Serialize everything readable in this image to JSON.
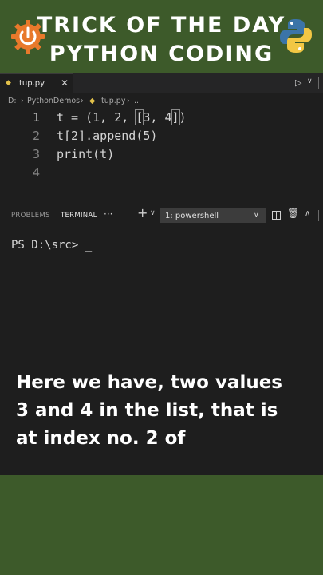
{
  "banner": {
    "line1": "TRICK OF THE DAY",
    "line2": "PYTHON CODING",
    "left_logo": "power-icon",
    "right_logo": "python-logo-icon",
    "colors": {
      "background": "#3d5a2a",
      "left_logo": "#e8792b",
      "python_blue": "#3b74a8",
      "python_yellow": "#f2c744"
    }
  },
  "editor": {
    "tab": {
      "icon": "python-file-icon",
      "label": "tup.py",
      "close": "✕"
    },
    "run_icon": "▷",
    "run_chevron": "∨",
    "breadcrumb": {
      "drive": "D:",
      "folder": "PythonDemos",
      "file": "tup.py",
      "more": "..."
    },
    "lines": [
      {
        "num": "1",
        "before": "t = (1, 2, ",
        "open": "[",
        "middle": "3, 4",
        "close": "]",
        "after": ")"
      },
      {
        "num": "2",
        "text": "t[2].append(5)"
      },
      {
        "num": "3",
        "text": "print(t)"
      },
      {
        "num": "4",
        "text": ""
      }
    ]
  },
  "panel": {
    "tabs": [
      "PROBLEMS",
      "TERMINAL"
    ],
    "active_tab": "TERMINAL",
    "more": "···",
    "new_terminal": "+",
    "new_terminal_chevron": "∨",
    "terminal_select": "1: powershell",
    "select_chevron": "∨",
    "trash": "🗑",
    "maximize": "∧"
  },
  "terminal": {
    "prompt": "PS D:\\src> _"
  },
  "caption": {
    "lines": [
      "Here we have, two values",
      "3 and 4 in the list, that is",
      "at index no. 2 of"
    ]
  }
}
